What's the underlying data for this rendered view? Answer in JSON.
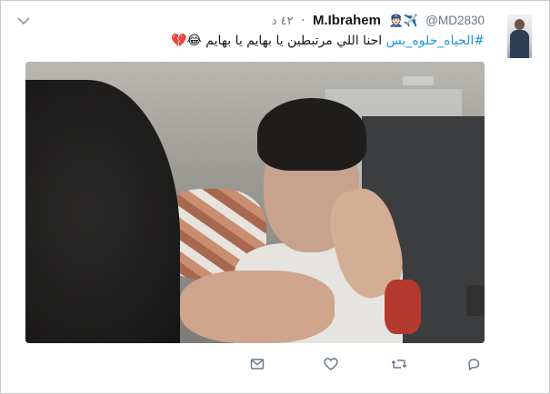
{
  "tweet": {
    "display_name": "M.Ibrahem",
    "badges": "👮🏻✈️",
    "handle": "@MD2830",
    "separator": "·",
    "time": "٤٢ د",
    "text_hashtag": "#الحياه_حلوه_بس",
    "text_body": " احنا اللي مرتبطين يا بهايم يا بهايم 😂💔"
  },
  "icons": {
    "more": "chevron-down-icon",
    "reply": "reply-icon",
    "retweet": "retweet-icon",
    "like": "heart-icon",
    "dm": "envelope-icon"
  },
  "colors": {
    "hashtag": "#1b95e0",
    "muted": "#657786",
    "text": "#14171a"
  }
}
